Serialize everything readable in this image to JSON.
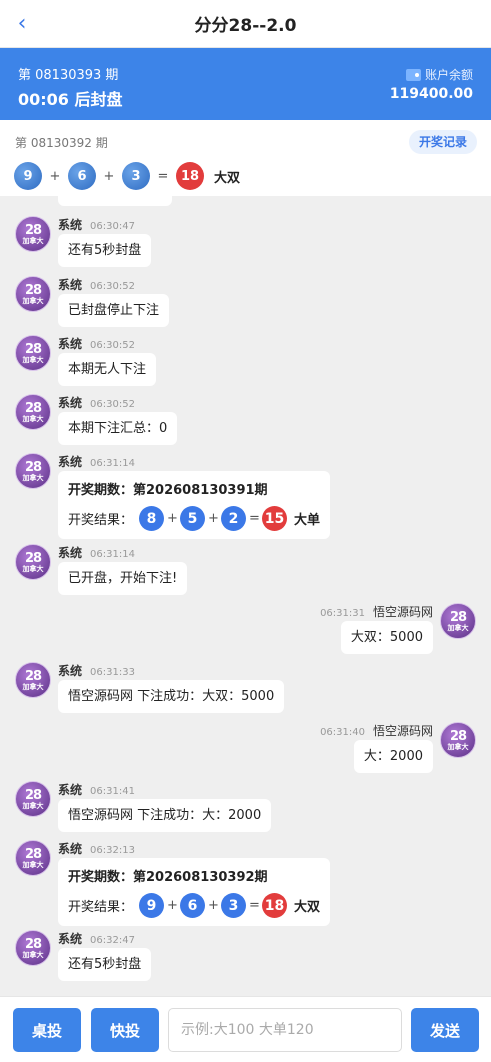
{
  "header": {
    "title": "分分28--2.0",
    "back_glyph": "‹"
  },
  "current": {
    "period": "第 08130393 期",
    "countdown": "00:06 后封盘"
  },
  "balance": {
    "label": "账户余额",
    "value": "119400.00"
  },
  "last": {
    "period": "第 08130392 期",
    "history_label": "开奖记录",
    "balls": [
      "9",
      "6",
      "3"
    ],
    "sum": "18",
    "result": "大双",
    "plus": "+",
    "equals": "="
  },
  "avatar": {
    "line1": "28",
    "line2": "加拿大"
  },
  "messages": [
    {
      "side": "left",
      "name": "系统",
      "time": "06:30:47",
      "text": "还有5秒封盘"
    },
    {
      "side": "left",
      "name": "系统",
      "time": "06:30:52",
      "text": "已封盘停止下注"
    },
    {
      "side": "left",
      "name": "系统",
      "time": "06:30:52",
      "text": "本期无人下注"
    },
    {
      "side": "left",
      "name": "系统",
      "time": "06:30:52",
      "text": "本期下注汇总：0"
    },
    {
      "side": "left",
      "name": "系统",
      "time": "06:31:14",
      "draw_title": "开奖期数：第202608130391期",
      "draw_label": "开奖结果：",
      "balls": [
        "8",
        "5",
        "2"
      ],
      "sum": "15",
      "result": "大单"
    },
    {
      "side": "left",
      "name": "系统",
      "time": "06:31:14",
      "text": "已开盘，开始下注!"
    },
    {
      "side": "right",
      "name": "悟空源码网",
      "time": "06:31:31",
      "text": "大双：5000"
    },
    {
      "side": "left",
      "name": "系统",
      "time": "06:31:33",
      "text": "悟空源码网 下注成功：大双：5000"
    },
    {
      "side": "right",
      "name": "悟空源码网",
      "time": "06:31:40",
      "text": "大：2000"
    },
    {
      "side": "left",
      "name": "系统",
      "time": "06:31:41",
      "text": "悟空源码网 下注成功：大：2000"
    },
    {
      "side": "left",
      "name": "系统",
      "time": "06:32:13",
      "draw_title": "开奖期数：第202608130392期",
      "draw_label": "开奖结果：",
      "balls": [
        "9",
        "6",
        "3"
      ],
      "sum": "18",
      "result": "大双"
    },
    {
      "side": "left",
      "name": "系统",
      "time": "06:32:47",
      "text": "还有5秒封盘"
    }
  ],
  "bottom": {
    "btn1": "桌投",
    "btn2": "快投",
    "placeholder": "示例:大100 大单120",
    "send": "发送"
  },
  "colors": {
    "accent": "#3d84e8",
    "ball_blue": "#3b78e7",
    "ball_red": "#e23c3c"
  }
}
